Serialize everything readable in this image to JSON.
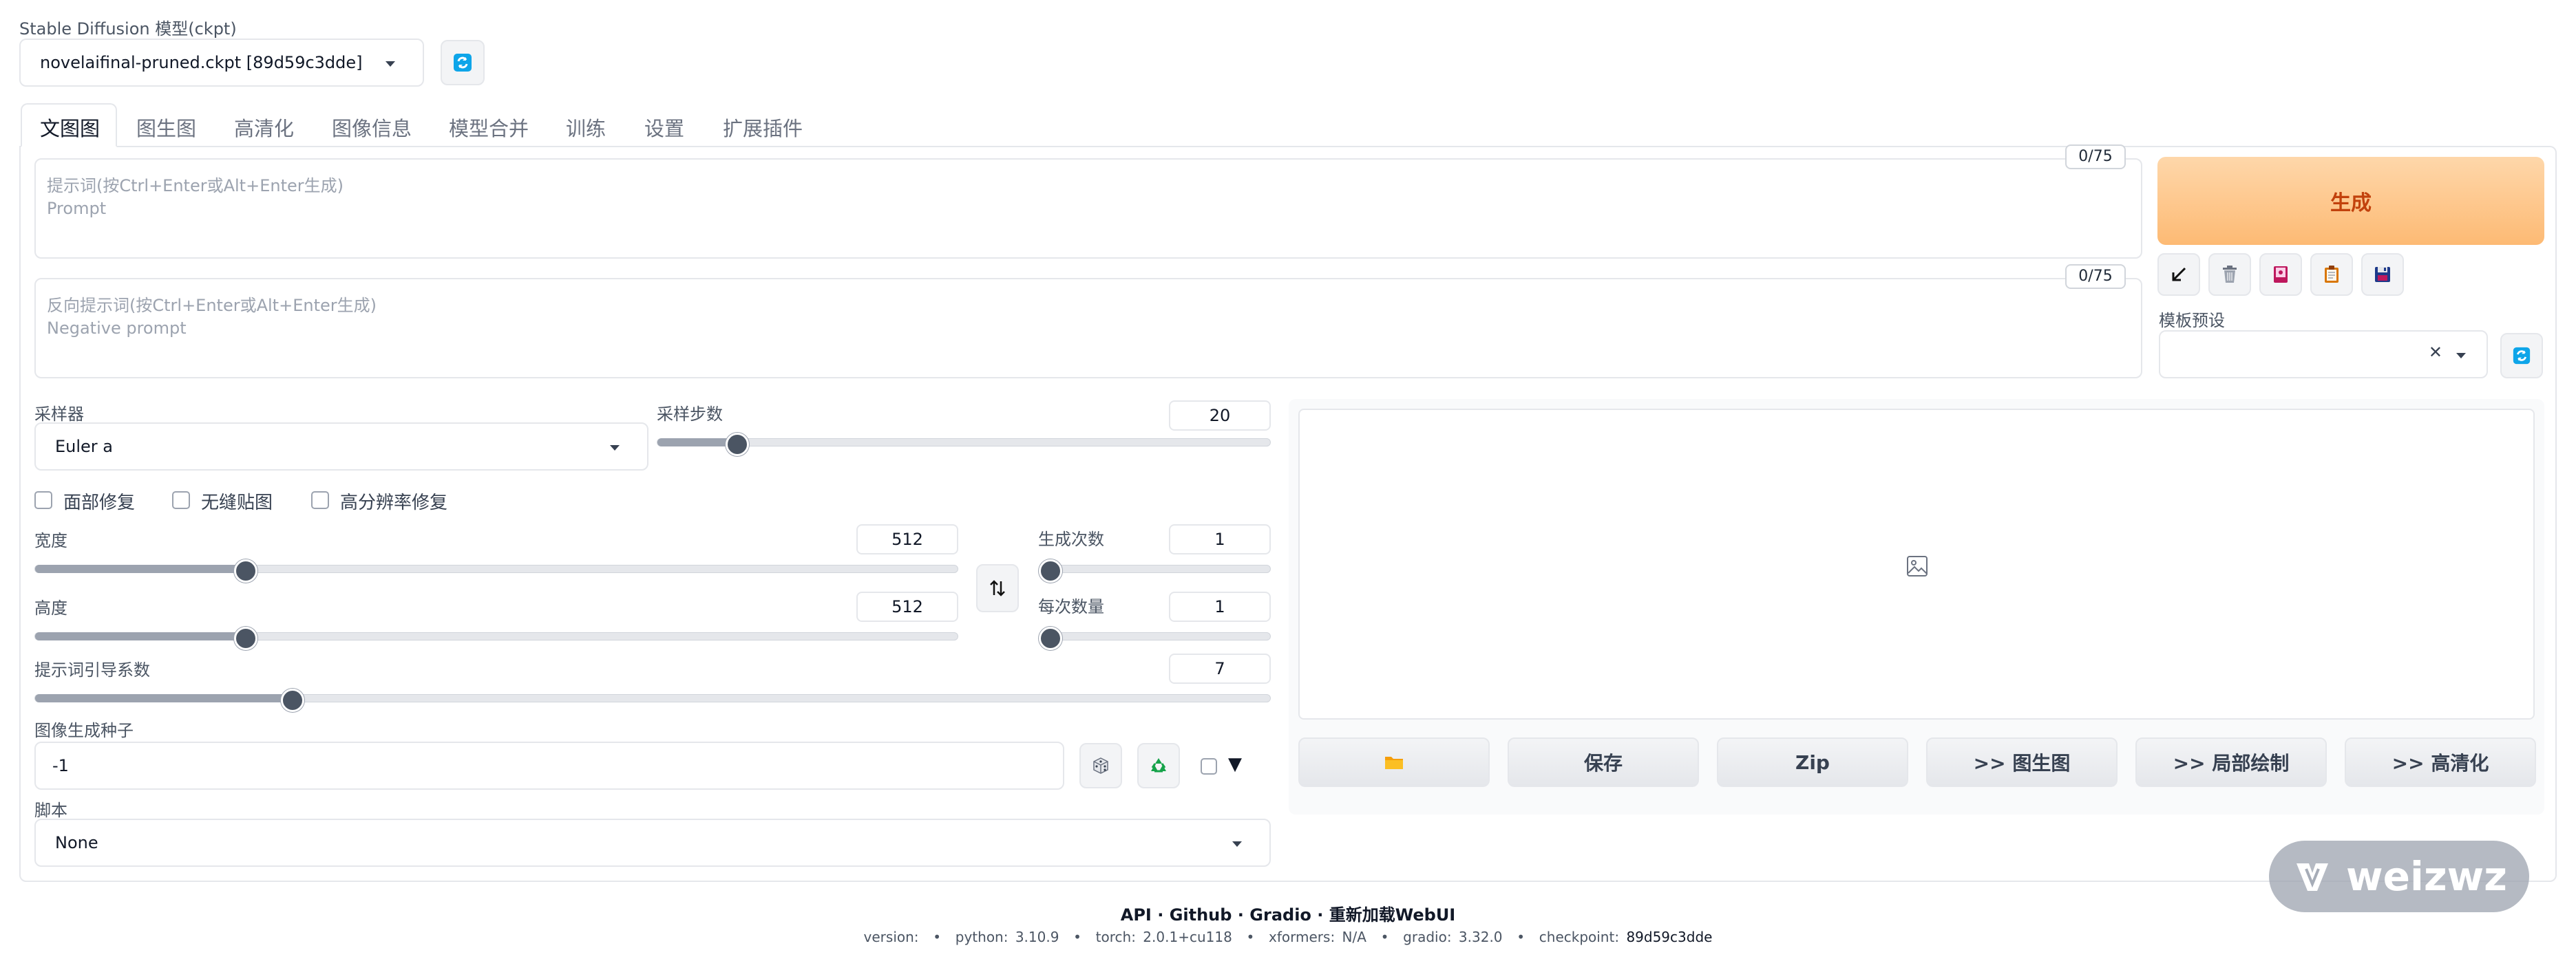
{
  "model": {
    "label": "Stable Diffusion 模型(ckpt)",
    "value": "novelaifinal-pruned.ckpt [89d59c3dde]"
  },
  "tabs": [
    "文图图",
    "图生图",
    "高清化",
    "图像信息",
    "模型合并",
    "训练",
    "设置",
    "扩展插件"
  ],
  "prompt": {
    "placeholder_line1": "提示词(按Ctrl+Enter或Alt+Enter生成)",
    "placeholder_line2": "Prompt",
    "counter": "0/75"
  },
  "negative_prompt": {
    "placeholder_line1": "反向提示词(按Ctrl+Enter或Alt+Enter生成)",
    "placeholder_line2": "Negative prompt",
    "counter": "0/75"
  },
  "generate": {
    "label": "生成"
  },
  "styles": {
    "label": "模板预设",
    "clear": "✕"
  },
  "sampler": {
    "label": "采样器",
    "value": "Euler a"
  },
  "steps": {
    "label": "采样步数",
    "value": "20",
    "min": 1,
    "max": 150,
    "current": 20
  },
  "checkboxes": {
    "face": "面部修复",
    "tiling": "无缝贴图",
    "hires": "高分辨率修复"
  },
  "width": {
    "label": "宽度",
    "value": "512",
    "min": 64,
    "max": 2048,
    "current": 512
  },
  "height": {
    "label": "高度",
    "value": "512",
    "min": 64,
    "max": 2048,
    "current": 512
  },
  "batch_count": {
    "label": "生成次数",
    "value": "1",
    "min": 1,
    "max": 100,
    "current": 1
  },
  "batch_size": {
    "label": "每次数量",
    "value": "1",
    "min": 1,
    "max": 8,
    "current": 1
  },
  "cfg": {
    "label": "提示词引导系数",
    "value": "7",
    "min": 1,
    "max": 30,
    "current": 7
  },
  "seed": {
    "label": "图像生成种子",
    "value": "-1",
    "extra_toggle": "▼"
  },
  "script": {
    "label": "脚本",
    "value": "None"
  },
  "output_buttons": {
    "save": "保存",
    "zip": "Zip",
    "img2img": ">> 图生图",
    "inpaint": ">> 局部绘制",
    "extras": ">> 高清化"
  },
  "footer": {
    "links": [
      "API",
      "Github",
      "Gradio",
      "重新加载WebUI"
    ],
    "separator": "·",
    "version_label": "version:",
    "python": "python: 3.10.9",
    "torch": "torch: 2.0.1+cu118",
    "xformers": "xformers: N/A",
    "gradio": "gradio: 3.32.0",
    "checkpoint_label": "checkpoint:",
    "checkpoint_value": "89d59c3dde",
    "dot": "•"
  },
  "watermark": {
    "text": "weizwz"
  },
  "colors": {
    "accent_orange": "#fdba74",
    "generate_text": "#c2410c",
    "refresh_blue": "#0ea5e9",
    "recycle_green": "#16a34a"
  }
}
